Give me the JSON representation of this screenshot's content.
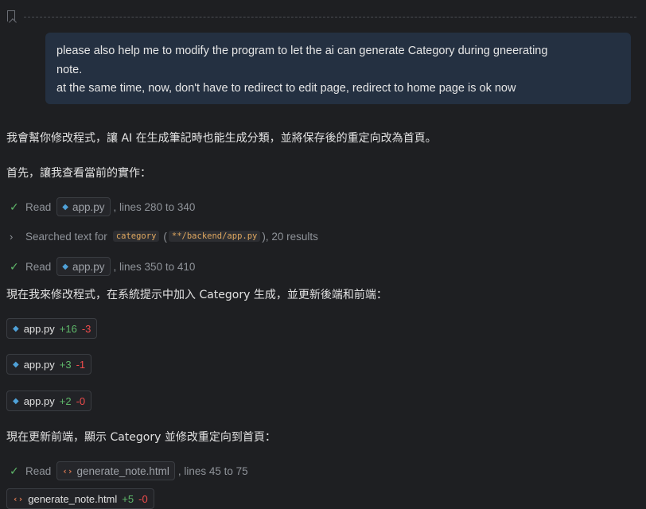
{
  "user_message": {
    "lines": [
      "please also help me to modify the program to let the ai can generate Category during gneerating",
      "note.",
      "at the same time, now, don't have to redirect to edit page, redirect to home page is ok now"
    ]
  },
  "response": {
    "intro": "我會幫你修改程式，讓 AI 在生成筆記時也能生成分類，並將保存後的重定向改為首頁。",
    "first": "首先，讓我查看當前的實作：",
    "step1": {
      "action": "Read",
      "file": "app.py",
      "detail": ", lines 280 to 340"
    },
    "step2": {
      "action": "Searched text for",
      "query": "category",
      "pattern": "**/backend/app.py",
      "open_paren": "(",
      "close_paren": "), 20 results"
    },
    "step3": {
      "action": "Read",
      "file": "app.py",
      "detail": ", lines 350 to 410"
    },
    "modify_text": "現在我來修改程式，在系統提示中加入 Category 生成，並更新後端和前端：",
    "edits": [
      {
        "file": "app.py",
        "added": "+16",
        "removed": "-3"
      },
      {
        "file": "app.py",
        "added": "+3",
        "removed": "-1"
      },
      {
        "file": "app.py",
        "added": "+2",
        "removed": "-0"
      }
    ],
    "frontend_text": "現在更新前端，顯示 Category 並修改重定向到首頁：",
    "step4": {
      "action": "Read",
      "file": "generate_note.html",
      "detail": ", lines 45 to 75"
    },
    "edit_html": {
      "file": "generate_note.html",
      "added": "+5",
      "removed": "-0"
    }
  },
  "icons": {
    "check": "check-icon",
    "chevron": "chevron-right-icon",
    "python": "python-file-icon",
    "html": "html-file-icon",
    "bookmark": "bookmark-icon"
  },
  "colors": {
    "background": "#1e1f22",
    "bubble": "#243041",
    "added": "#5fb86a",
    "removed": "#f14c4c"
  }
}
